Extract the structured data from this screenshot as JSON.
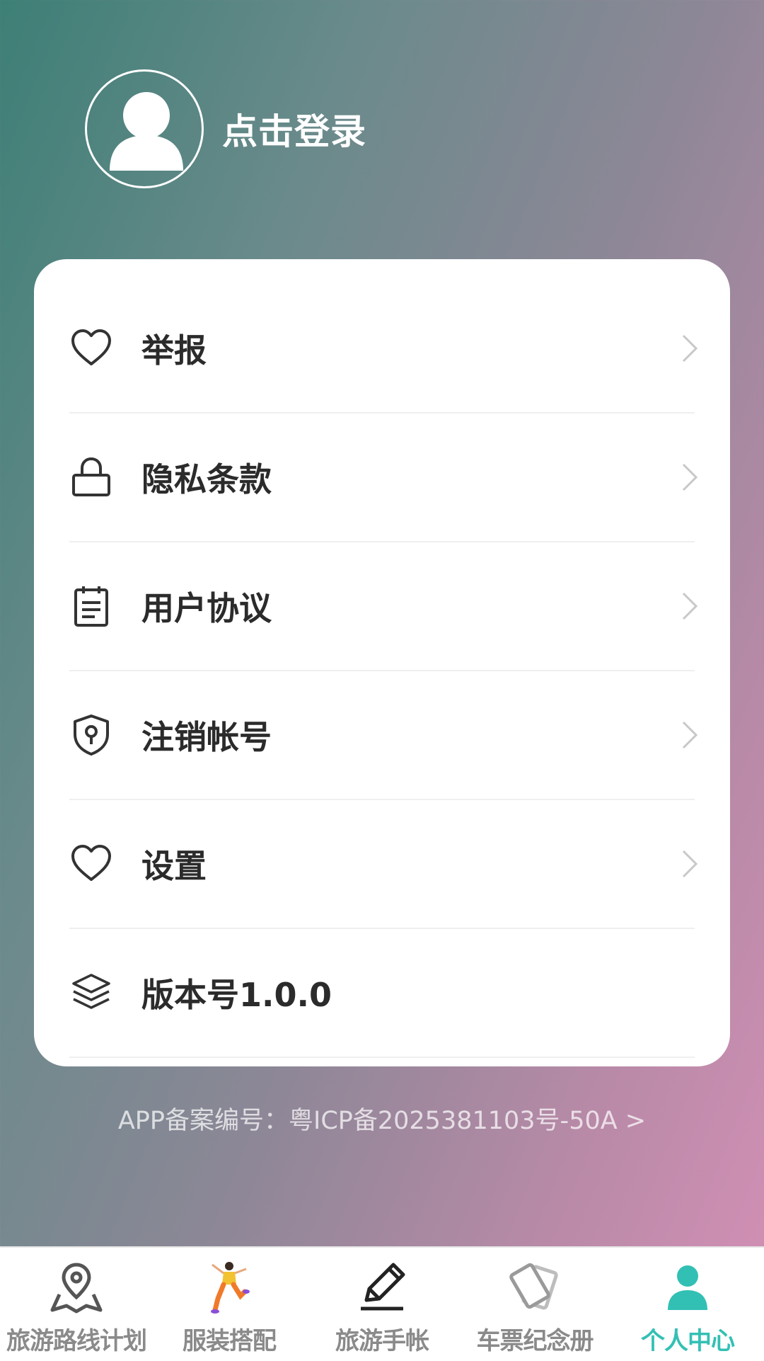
{
  "profile": {
    "login_text": "点击登录"
  },
  "menu": {
    "items": [
      {
        "label": "举报",
        "icon": "heart-icon"
      },
      {
        "label": "隐私条款",
        "icon": "lock-icon"
      },
      {
        "label": "用户协议",
        "icon": "document-icon"
      },
      {
        "label": "注销帐号",
        "icon": "shield-key-icon"
      },
      {
        "label": "设置",
        "icon": "heart-icon"
      },
      {
        "label": "版本号1.0.0",
        "icon": "layers-icon"
      }
    ]
  },
  "footer": {
    "icp_text": "APP备案编号：粤ICP备2025381103号-50A >"
  },
  "tabbar": {
    "tabs": [
      {
        "label": "旅游路线计划",
        "icon": "map-pin-icon"
      },
      {
        "label": "服装搭配",
        "icon": "dancer-illustration-icon"
      },
      {
        "label": "旅游手帐",
        "icon": "pen-icon"
      },
      {
        "label": "车票纪念册",
        "icon": "ticket-cards-icon"
      },
      {
        "label": "个人中心",
        "icon": "user-icon",
        "active": true
      }
    ]
  },
  "colors": {
    "accent": "#33c0b4",
    "tab_inactive": "#8a8a8a",
    "menu_text": "#2b2b2b"
  }
}
